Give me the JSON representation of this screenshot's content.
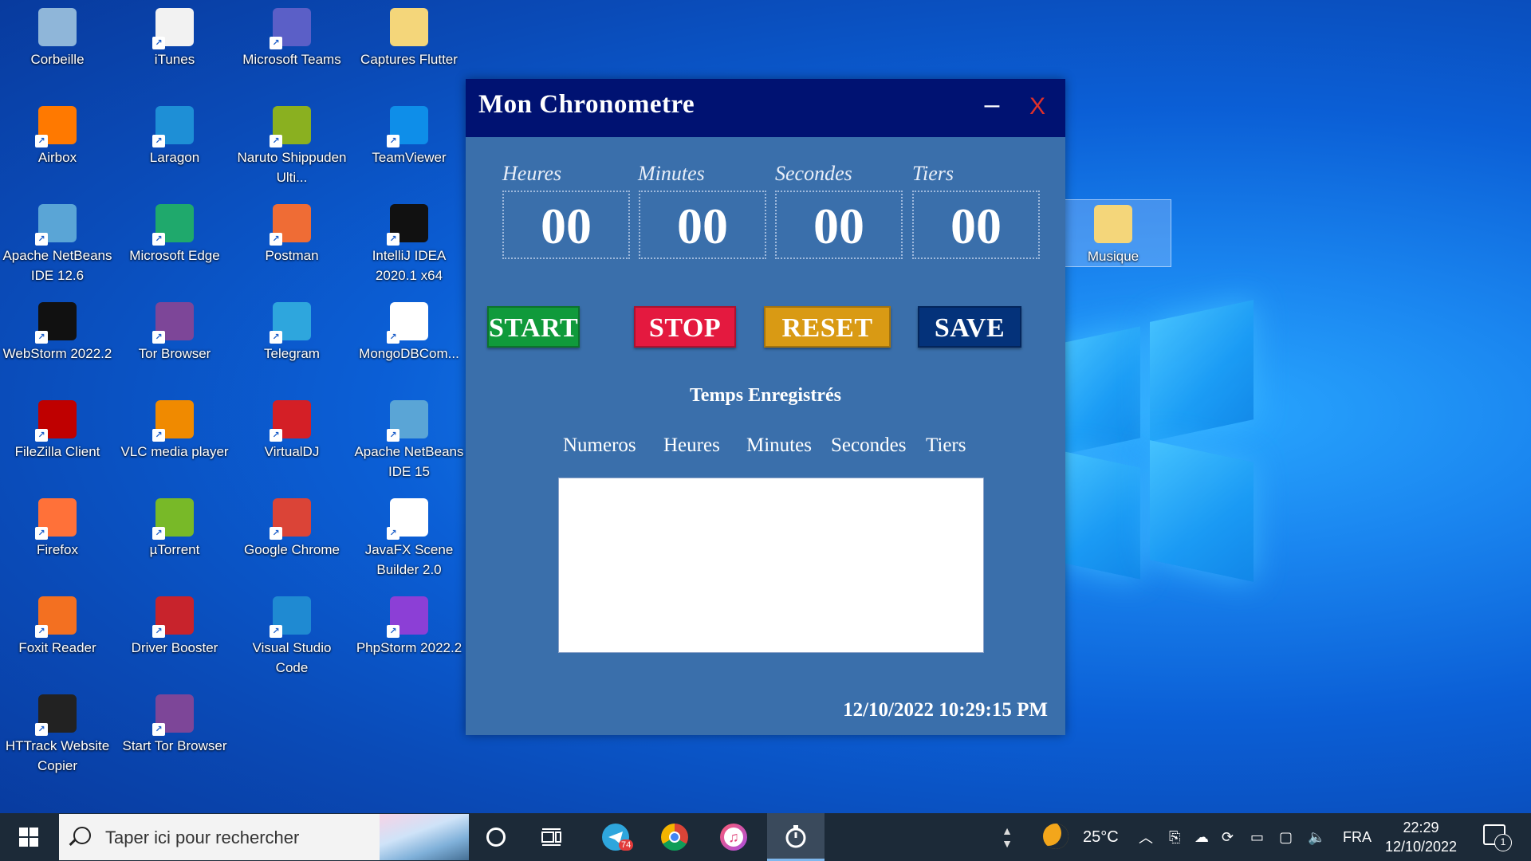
{
  "desktop": {
    "icons": [
      {
        "label": "Corbeille",
        "icon": "recycle-bin-icon",
        "color": "#8fb6d9"
      },
      {
        "label": "iTunes",
        "icon": "itunes-icon",
        "color": "#f2f2f2"
      },
      {
        "label": "Microsoft Teams",
        "icon": "teams-icon",
        "color": "#5b5fc7"
      },
      {
        "label": "Captures Flutter",
        "icon": "folder-icon",
        "color": "#f4d67a"
      },
      {
        "label": "Airbox",
        "icon": "airbox-icon",
        "color": "#ff7900"
      },
      {
        "label": "Laragon",
        "icon": "laragon-icon",
        "color": "#1e8fd6"
      },
      {
        "label": "Naruto Shippuden Ulti...",
        "icon": "naruto-game-icon",
        "color": "#8ab020"
      },
      {
        "label": "TeamViewer",
        "icon": "teamviewer-icon",
        "color": "#0e8ee9"
      },
      {
        "label": "Apache NetBeans IDE 12.6",
        "icon": "netbeans-icon",
        "color": "#5aa5d6"
      },
      {
        "label": "Microsoft Edge",
        "icon": "edge-icon",
        "color": "#1fa96c"
      },
      {
        "label": "Postman",
        "icon": "postman-icon",
        "color": "#ef6c35"
      },
      {
        "label": "IntelliJ IDEA 2020.1 x64",
        "icon": "intellij-icon",
        "color": "#111111"
      },
      {
        "label": "WebStorm 2022.2",
        "icon": "webstorm-icon",
        "color": "#111111"
      },
      {
        "label": "Tor Browser",
        "icon": "tor-browser-icon",
        "color": "#7d4698"
      },
      {
        "label": "Telegram",
        "icon": "telegram-icon",
        "color": "#2ea6dd"
      },
      {
        "label": "MongoDBCom...",
        "icon": "mongodb-icon",
        "color": "#ffffff"
      },
      {
        "label": "FileZilla Client",
        "icon": "filezilla-icon",
        "color": "#bf0000"
      },
      {
        "label": "VLC media player",
        "icon": "vlc-icon",
        "color": "#f08a00"
      },
      {
        "label": "VirtualDJ",
        "icon": "virtualdj-icon",
        "color": "#d41f26"
      },
      {
        "label": "Apache NetBeans IDE 15",
        "icon": "netbeans-icon",
        "color": "#5aa5d6"
      },
      {
        "label": "Firefox",
        "icon": "firefox-icon",
        "color": "#ff7139"
      },
      {
        "label": "µTorrent",
        "icon": "utorrent-icon",
        "color": "#78b928"
      },
      {
        "label": "Google Chrome",
        "icon": "chrome-icon",
        "color": "#db4437"
      },
      {
        "label": "JavaFX Scene Builder 2.0",
        "icon": "scene-builder-icon",
        "color": "#ffffff"
      },
      {
        "label": "Foxit Reader",
        "icon": "foxit-icon",
        "color": "#f37021"
      },
      {
        "label": "Driver Booster",
        "icon": "driver-booster-icon",
        "color": "#c8232c"
      },
      {
        "label": "Visual Studio Code",
        "icon": "vscode-icon",
        "color": "#1f8ad2"
      },
      {
        "label": "PhpStorm 2022.2",
        "icon": "phpstorm-icon",
        "color": "#8c3fd6"
      },
      {
        "label": "HTTrack Website Copier",
        "icon": "httrack-icon",
        "color": "#222222"
      },
      {
        "label": "Start Tor Browser",
        "icon": "tor-browser-icon",
        "color": "#7d4698"
      },
      {
        "label": "Musique",
        "icon": "music-folder-icon",
        "color": "#f4d67a"
      }
    ]
  },
  "app": {
    "title": "Mon Chronometre",
    "minimize_label": "–",
    "close_label": "X",
    "units": [
      {
        "label": "Heures",
        "value": "00"
      },
      {
        "label": "Minutes",
        "value": "00"
      },
      {
        "label": "Secondes",
        "value": "00"
      },
      {
        "label": "Tiers",
        "value": "00"
      }
    ],
    "buttons": {
      "start": "START",
      "stop": "STOP",
      "reset": "RESET",
      "save": "SAVE"
    },
    "saved_title": "Temps Enregistrés",
    "columns": [
      "Numeros",
      "Heures",
      "Minutes",
      "Secondes",
      "Tiers"
    ],
    "datetime": "12/10/2022  10:29:15 PM",
    "colors": {
      "titlebar": "#001272",
      "body": "#3a6fab",
      "start": "#109a3b",
      "stop": "#e4193f",
      "reset": "#d99a14",
      "save": "#04327a",
      "close": "#e0302a"
    }
  },
  "taskbar": {
    "search_placeholder": "Taper ici pour rechercher",
    "apps": [
      {
        "icon": "telegram-icon",
        "badge": "74"
      },
      {
        "icon": "chrome-icon"
      },
      {
        "icon": "itunes-icon"
      },
      {
        "icon": "stopwatch-icon"
      }
    ],
    "temperature": "25°C",
    "language": "FRA",
    "time": "22:29",
    "date": "12/10/2022",
    "notifications": "1"
  }
}
